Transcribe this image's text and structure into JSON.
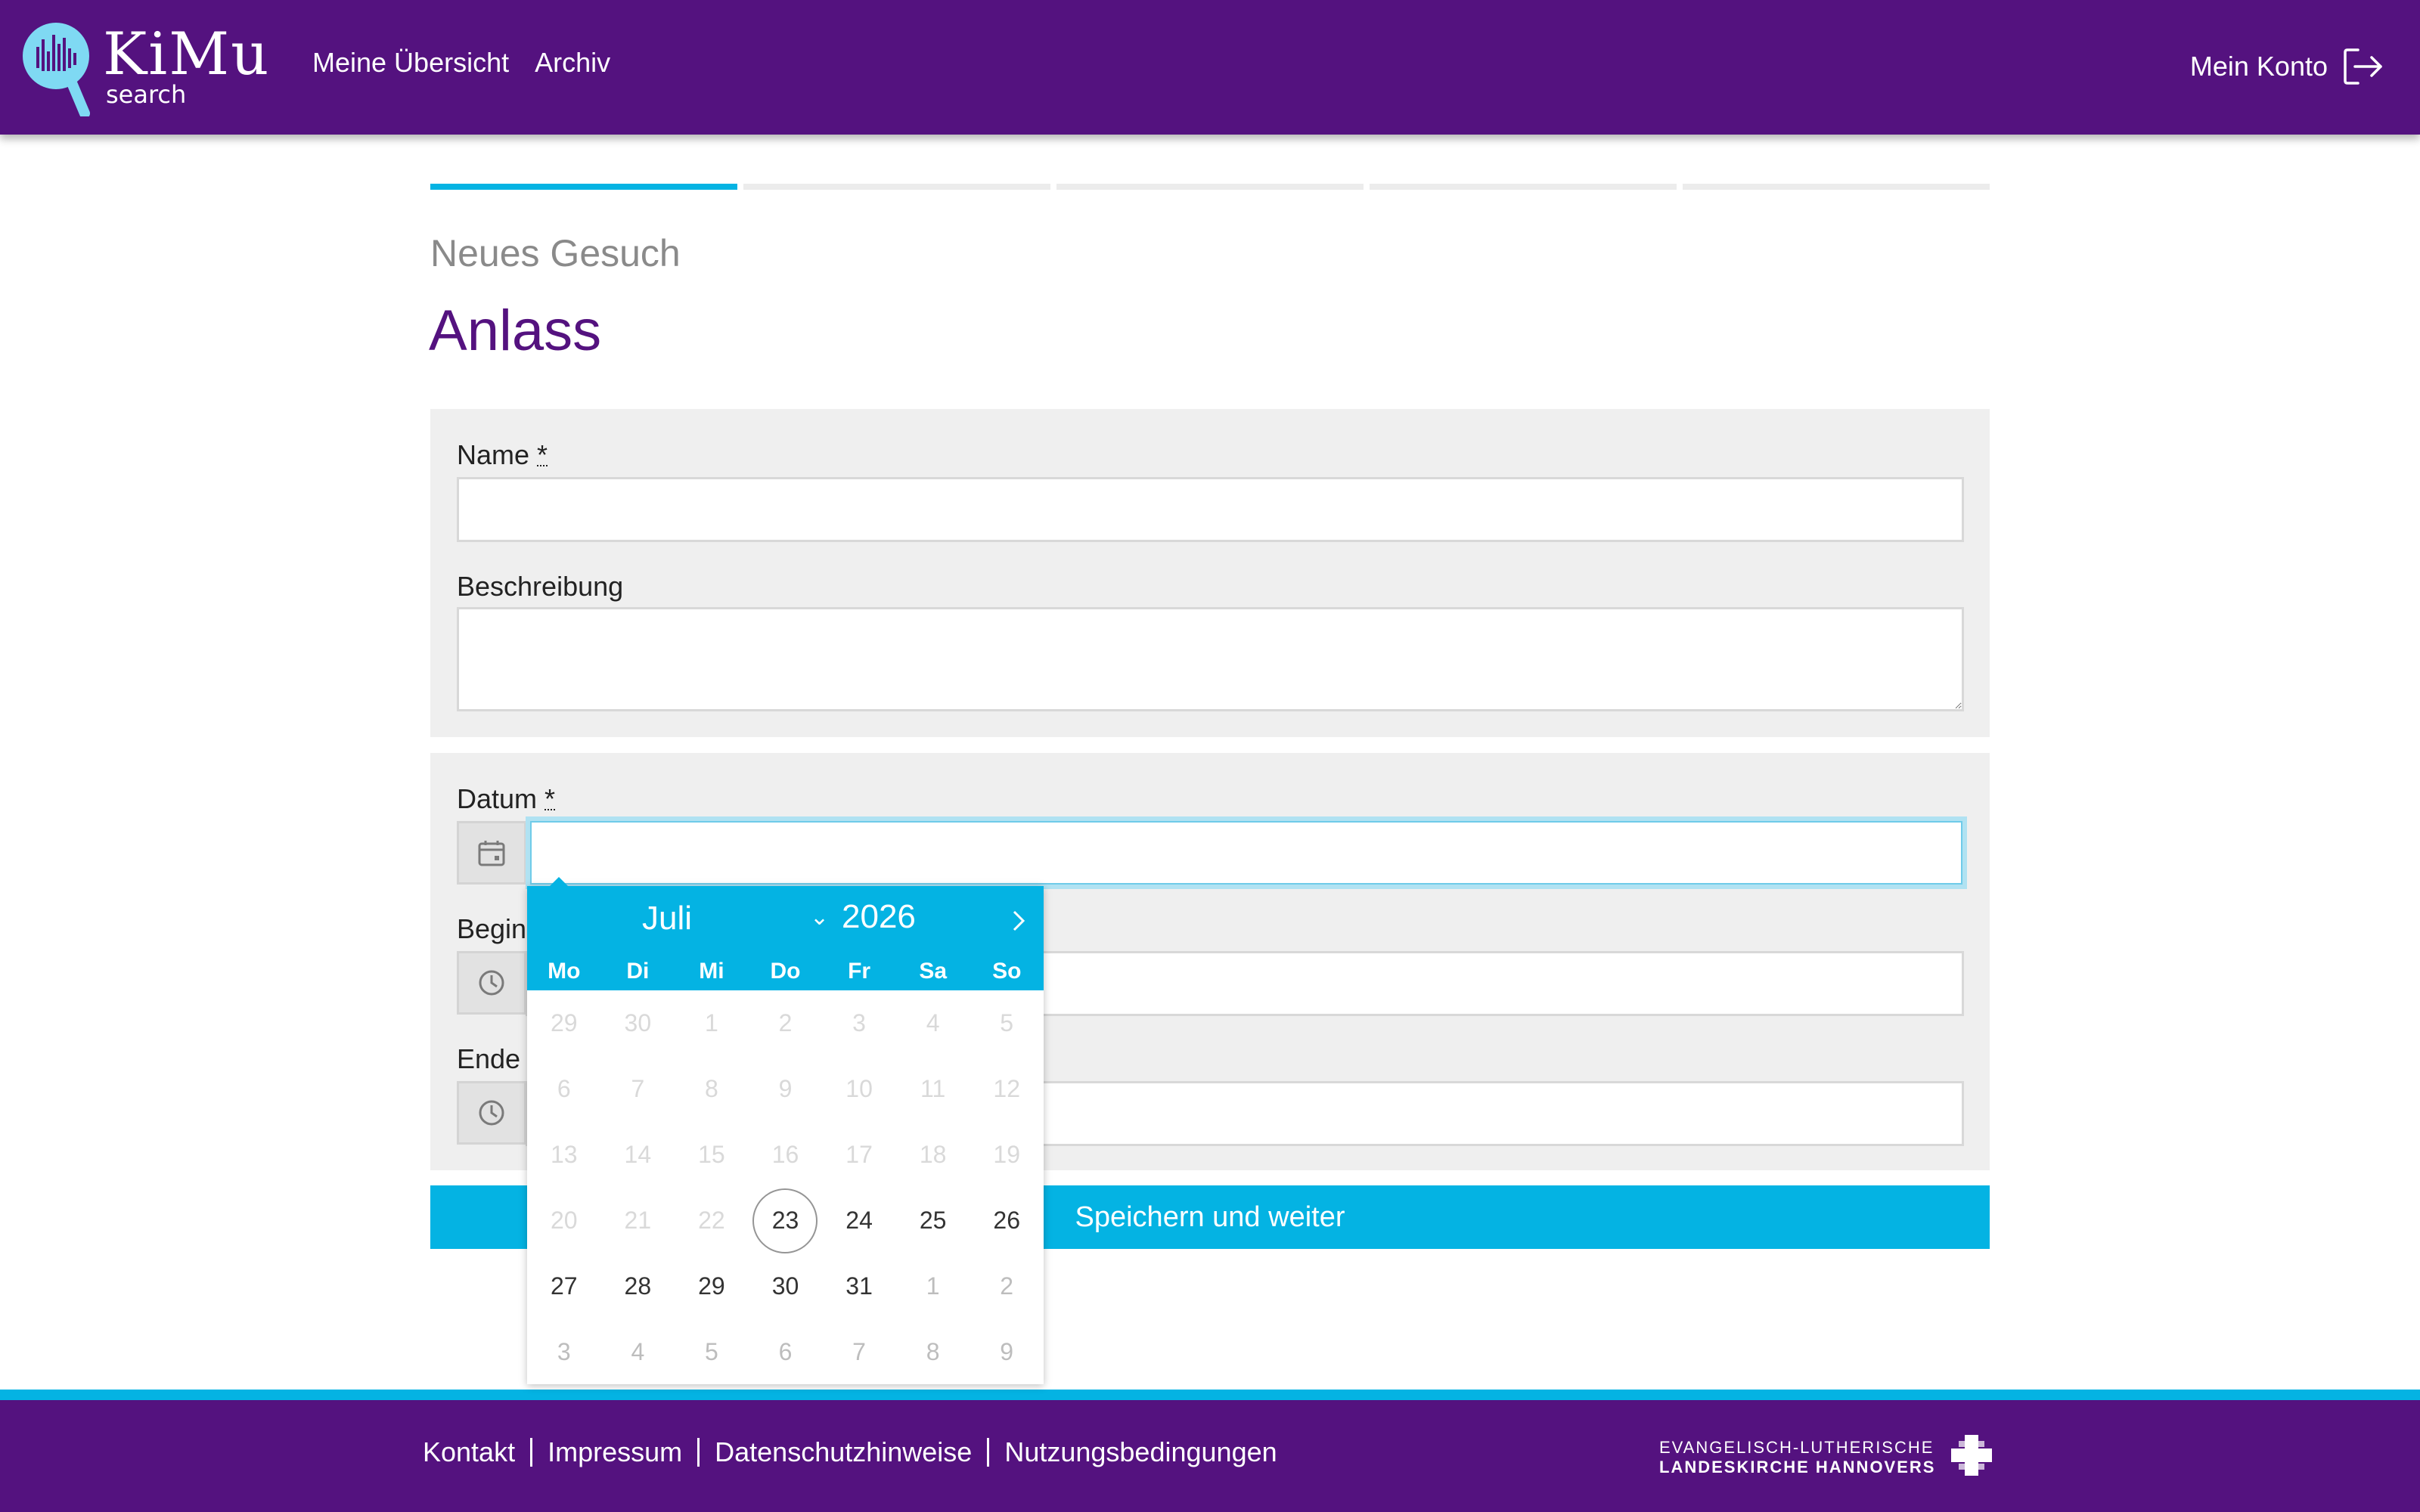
{
  "header": {
    "logo_title": "KiMu",
    "logo_sub": "search",
    "nav": [
      "Meine Übersicht",
      "Archiv"
    ],
    "account_label": "Mein Konto",
    "brand_color": "#54127f",
    "accent_color": "#04b3e3"
  },
  "progress": {
    "steps": 5,
    "current_step": 1
  },
  "page": {
    "subtitle": "Neues Gesuch",
    "title": "Anlass"
  },
  "form": {
    "name_label": "Name",
    "required_mark": "*",
    "name_value": "",
    "description_label": "Beschreibung",
    "description_value": "",
    "date_label": "Datum",
    "date_value": "",
    "begin_label": "Begin",
    "begin_value": "",
    "end_label": "Ende",
    "end_value": "",
    "submit_label": "Speichern und weiter"
  },
  "calendar": {
    "month": "Juli",
    "year": "2026",
    "weekdays": [
      "Mo",
      "Di",
      "Mi",
      "Do",
      "Fr",
      "Sa",
      "So"
    ],
    "weeks": [
      [
        "29",
        "30",
        "1",
        "2",
        "3",
        "4",
        "5"
      ],
      [
        "6",
        "7",
        "8",
        "9",
        "10",
        "11",
        "12"
      ],
      [
        "13",
        "14",
        "15",
        "16",
        "17",
        "18",
        "19"
      ],
      [
        "20",
        "21",
        "22",
        "23",
        "24",
        "25",
        "26"
      ],
      [
        "27",
        "28",
        "29",
        "30",
        "31",
        "1",
        "2"
      ],
      [
        "3",
        "4",
        "5",
        "6",
        "7",
        "8",
        "9"
      ]
    ],
    "today": "23"
  },
  "footer": {
    "links": [
      "Kontakt",
      "Impressum",
      "Datenschutzhinweise",
      "Nutzungsbedingungen"
    ],
    "church_line1": "EVANGELISCH-LUTHERISCHE",
    "church_line2": "LANDESKIRCHE HANNOVERS"
  }
}
